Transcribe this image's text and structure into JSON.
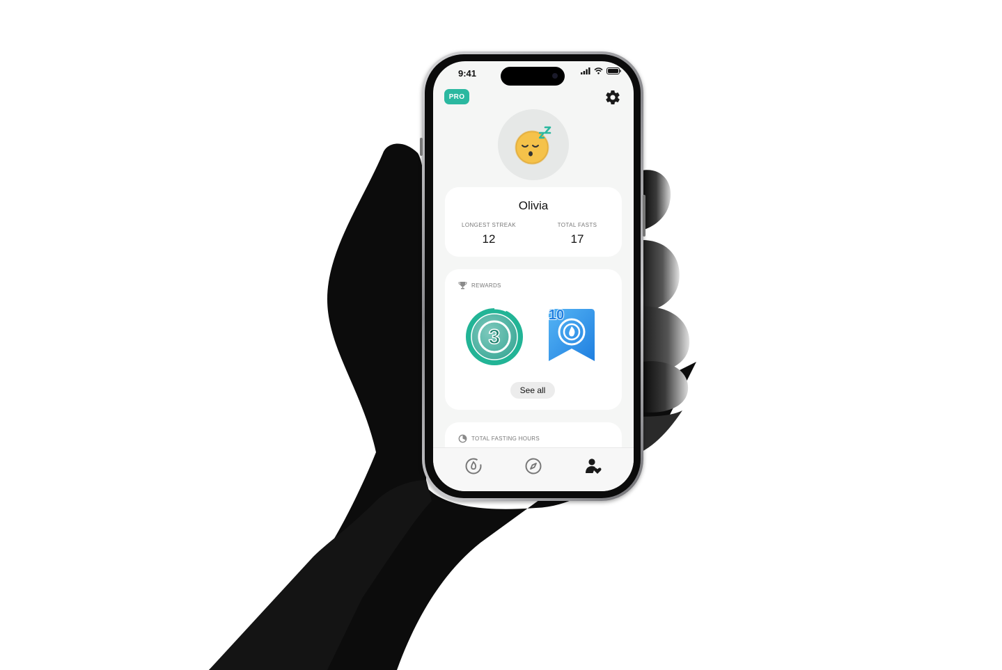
{
  "status_bar": {
    "time": "9:41",
    "icons": [
      "cellular-signal-icon",
      "wifi-icon",
      "battery-icon"
    ]
  },
  "header": {
    "badge": "PRO",
    "settings_icon": "gear-icon"
  },
  "profile": {
    "avatar_icon": "sleeping-face-icon",
    "name": "Olivia",
    "stats": [
      {
        "label": "LONGEST STREAK",
        "value": "12"
      },
      {
        "label": "TOTAL FASTS",
        "value": "17"
      }
    ]
  },
  "rewards": {
    "title": "REWARDS",
    "title_icon": "trophy-icon",
    "badges": [
      {
        "icon": "streak-3-badge-icon",
        "number": "3",
        "color": "#2bb8a0"
      },
      {
        "icon": "fast-10-ribbon-icon",
        "number": "10",
        "color": "#2b8fe8"
      }
    ],
    "see_all_label": "See all"
  },
  "fasting_hours": {
    "title": "TOTAL FASTING HOURS",
    "title_icon": "timer-icon"
  },
  "tab_bar": {
    "tabs": [
      {
        "name": "timer",
        "icon": "flame-timer-icon",
        "active": false
      },
      {
        "name": "explore",
        "icon": "compass-icon",
        "active": false
      },
      {
        "name": "profile",
        "icon": "user-heart-icon",
        "active": true
      }
    ]
  },
  "colors": {
    "accent": "#2bb8a0",
    "blue": "#2b8fe8",
    "screen_bg": "#f5f6f5"
  }
}
